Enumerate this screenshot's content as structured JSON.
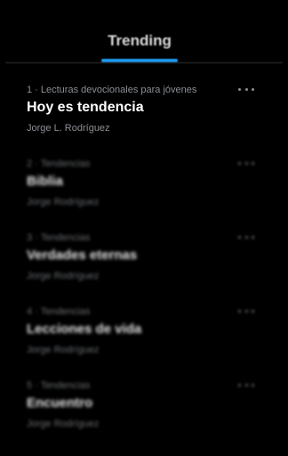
{
  "tabs": {
    "active_label": "Trending"
  },
  "colors": {
    "accent": "#1d9bf0",
    "background": "#000000",
    "divider": "#2f3336",
    "secondary_text": "#8b8f94",
    "primary_text": "#ffffff"
  },
  "trends": [
    {
      "meta": "1 · Lecturas devocionales para jóvenes",
      "title": "Hoy es tendencia",
      "author": "Jorge L. Rodríguez",
      "more_icon": "more-horizontal-icon"
    },
    {
      "meta": "2 · Tendencias",
      "title": "Biblia",
      "author": "Jorge Rodríguez",
      "more_icon": "more-horizontal-icon"
    },
    {
      "meta": "3 · Tendencias",
      "title": "Verdades eternas",
      "author": "Jorge Rodríguez",
      "more_icon": "more-horizontal-icon"
    },
    {
      "meta": "4 · Tendencias",
      "title": "Lecciones de vida",
      "author": "Jorge Rodríguez",
      "more_icon": "more-horizontal-icon"
    },
    {
      "meta": "5 · Tendencias",
      "title": "Encuentro",
      "author": "Jorge Rodríguez",
      "more_icon": "more-horizontal-icon"
    }
  ]
}
